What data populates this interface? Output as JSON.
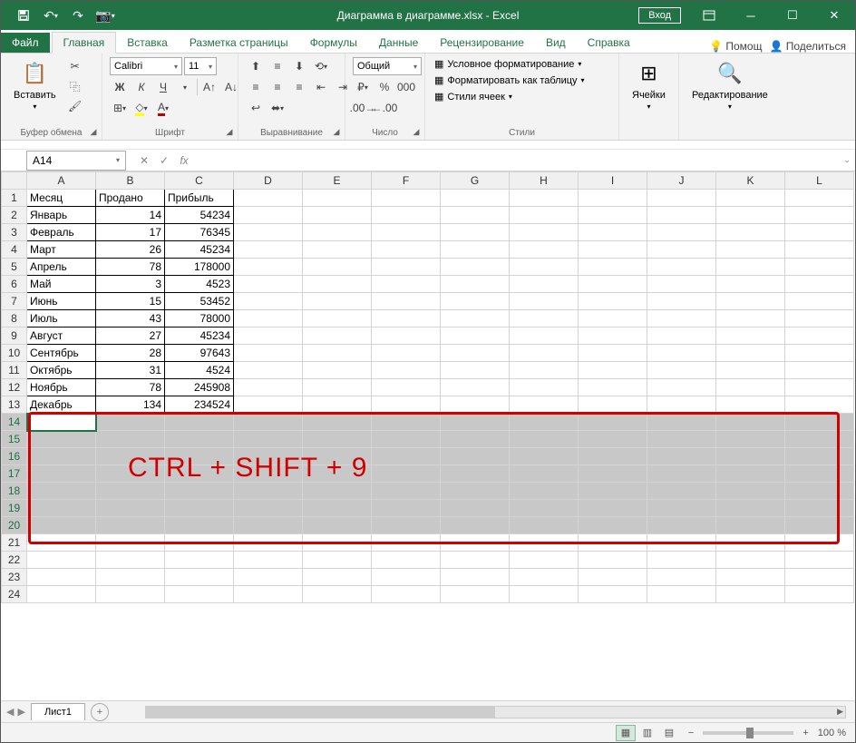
{
  "title": "Диаграмма в диаграмме.xlsx - Excel",
  "login": "Вход",
  "tabs": {
    "file": "Файл",
    "home": "Главная",
    "insert": "Вставка",
    "layout": "Разметка страницы",
    "formulas": "Формулы",
    "data": "Данные",
    "review": "Рецензирование",
    "view": "Вид",
    "help": "Справка"
  },
  "help_search": "Помощ",
  "share": "Поделиться",
  "groups": {
    "clipboard": "Буфер обмена",
    "font": "Шрифт",
    "align": "Выравнивание",
    "number": "Число",
    "styles": "Стили",
    "cells": "Ячейки",
    "editing": "Редактирование"
  },
  "paste": "Вставить",
  "font": {
    "name": "Calibri",
    "size": "11"
  },
  "number_format": "Общий",
  "styles": {
    "cond": "Условное форматирование",
    "table": "Форматировать как таблицу",
    "cell": "Стили ячеек"
  },
  "cells_btn": "Ячейки",
  "editing_btn": "Редактирование",
  "name_box": "A14",
  "columns": [
    "A",
    "B",
    "C",
    "D",
    "E",
    "F",
    "G",
    "H",
    "I",
    "J",
    "K",
    "L"
  ],
  "rows": [
    {
      "n": 1,
      "a": "Месяц",
      "b": "Продано",
      "c": "Прибыль"
    },
    {
      "n": 2,
      "a": "Январь",
      "b": "14",
      "c": "54234"
    },
    {
      "n": 3,
      "a": "Февраль",
      "b": "17",
      "c": "76345"
    },
    {
      "n": 4,
      "a": "Март",
      "b": "26",
      "c": "45234"
    },
    {
      "n": 5,
      "a": "Апрель",
      "b": "78",
      "c": "178000"
    },
    {
      "n": 6,
      "a": "Май",
      "b": "3",
      "c": "4523"
    },
    {
      "n": 7,
      "a": "Июнь",
      "b": "15",
      "c": "53452"
    },
    {
      "n": 8,
      "a": "Июль",
      "b": "43",
      "c": "78000"
    },
    {
      "n": 9,
      "a": "Август",
      "b": "27",
      "c": "45234"
    },
    {
      "n": 10,
      "a": "Сентябрь",
      "b": "28",
      "c": "97643"
    },
    {
      "n": 11,
      "a": "Октябрь",
      "b": "31",
      "c": "4524"
    },
    {
      "n": 12,
      "a": "Ноябрь",
      "b": "78",
      "c": "245908"
    },
    {
      "n": 13,
      "a": "Декабрь",
      "b": "134",
      "c": "234524"
    }
  ],
  "selected_rows": [
    14,
    15,
    16,
    17,
    18,
    19,
    20
  ],
  "empty_rows": [
    21,
    22,
    23,
    24
  ],
  "overlay_text": "CTRL + SHIFT + 9",
  "sheet": "Лист1",
  "zoom": "100 %"
}
